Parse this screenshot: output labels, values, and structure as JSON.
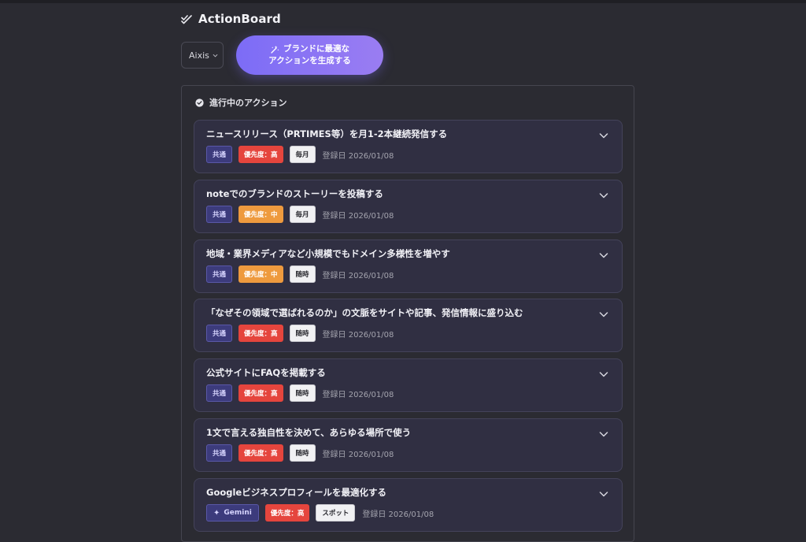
{
  "app": {
    "title": "ActionBoard",
    "icon": "double-check-icon"
  },
  "controls": {
    "brand_select": {
      "value": "Aixis",
      "icon": "chevron-down-icon"
    },
    "generate_button": {
      "line1": "ブランドに最適な",
      "line2": "アクションを生成する",
      "icon": "magic-wand-icon"
    }
  },
  "section": {
    "title": "進行中のアクション",
    "icon": "check-circle-icon"
  },
  "colors": {
    "background": "#2b2b32",
    "card": "#302f42",
    "accent_start": "#7c6cf6",
    "accent_end": "#9a7df2",
    "priority_high": "#e5453d",
    "priority_mid": "#ee9a3e",
    "scope_tag": "#3c3b7c"
  },
  "actions": [
    {
      "title": "ニュースリリース（PRTIMES等）を月1-2本継続発信する",
      "scope": "共通",
      "priority": "優先度：高",
      "frequency": "毎月",
      "date": "登録日 2026/01/08"
    },
    {
      "title": "noteでのブランドのストーリーを投稿する",
      "scope": "共通",
      "priority": "優先度：中",
      "frequency": "毎月",
      "date": "登録日 2026/01/08"
    },
    {
      "title": "地域・業界メディアなど小規模でもドメイン多様性を増やす",
      "scope": "共通",
      "priority": "優先度：中",
      "frequency": "随時",
      "date": "登録日 2026/01/08"
    },
    {
      "title": "「なぜその領域で選ばれるのか」の文脈をサイトや記事、発信情報に盛り込む",
      "scope": "共通",
      "priority": "優先度：高",
      "frequency": "随時",
      "date": "登録日 2026/01/08"
    },
    {
      "title": "公式サイトにFAQを掲載する",
      "scope": "共通",
      "priority": "優先度：高",
      "frequency": "随時",
      "date": "登録日 2026/01/08"
    },
    {
      "title": "1文で言える独自性を決めて、あらゆる場所で使う",
      "scope": "共通",
      "priority": "優先度：高",
      "frequency": "随時",
      "date": "登録日 2026/01/08"
    },
    {
      "title": "Googleビジネスプロフィールを最適化する",
      "scope": "Gemini",
      "priority": "優先度：高",
      "frequency": "スポット",
      "date": "登録日 2026/01/08",
      "scope_icon": "sparkle-icon"
    }
  ]
}
